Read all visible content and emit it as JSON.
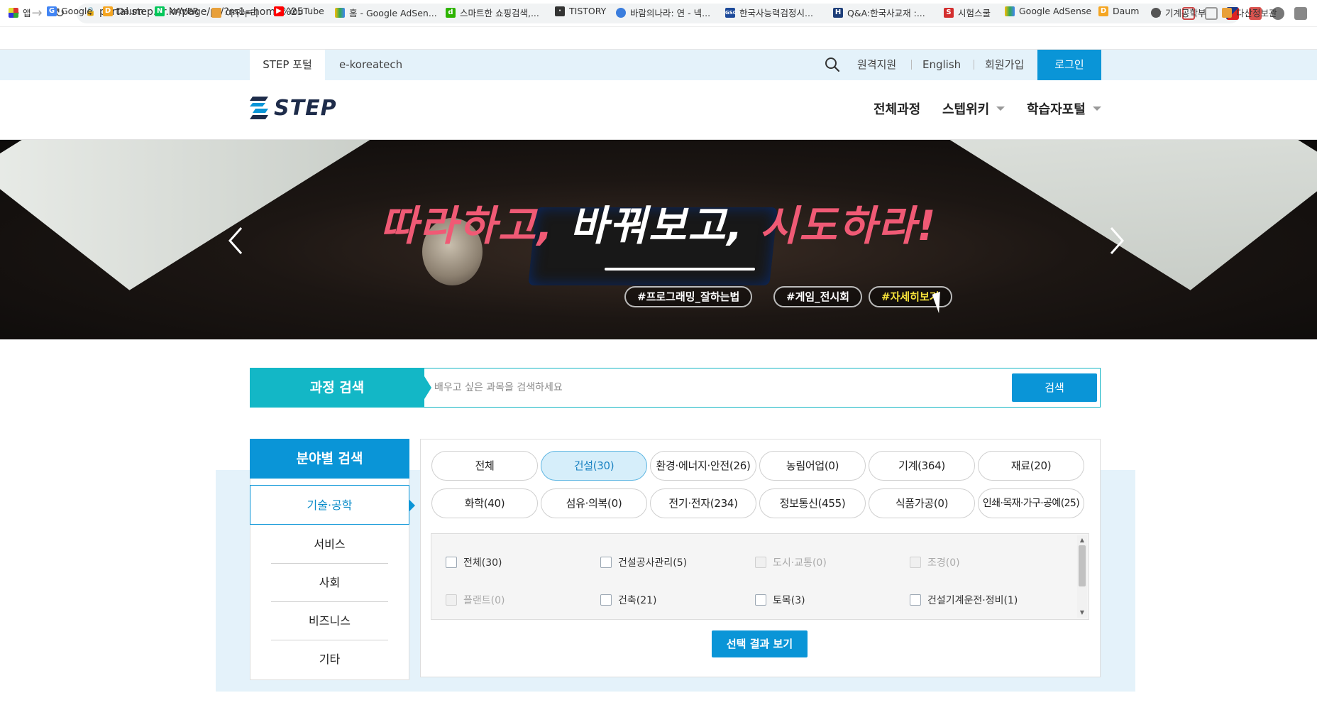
{
  "browser": {
    "url": "portal.step.or.kr/page/pt/?m1=home%25",
    "bookmarks": [
      "앱",
      "Google",
      "Daum",
      "NAVER",
      "아우누리",
      "YouTube",
      "홈 - Google AdSen...",
      "스마트한 쇼핑검색,...",
      "TISTORY",
      "바람의나라: 연 - 넥...",
      "한국사능력검정시...",
      "Q&A:한국사교재 :...",
      "시험스쿨",
      "Google AdSense",
      "Daum",
      "기계공학부",
      "다산정보관"
    ]
  },
  "topbar": {
    "tab_step": "STEP 포털",
    "tab_ekt": "e-koreatech",
    "remote": "원격지원",
    "english": "English",
    "signup": "회원가입",
    "login": "로그인"
  },
  "header": {
    "logo": "STEP",
    "nav": [
      "전체과정",
      "스텝위키",
      "학습자포털"
    ]
  },
  "banner": {
    "slogan_1": "따라하고,",
    "slogan_2": " 바꿔보고,",
    "slogan_3": " 시도하라!",
    "tags": [
      "#프로그래밍_잘하는법",
      "#게임_전시회",
      "#자세히보기"
    ]
  },
  "course_search": {
    "label": "과정 검색",
    "placeholder": "배우고 싶은 과목을 검색하세요",
    "button": "검색"
  },
  "field_search": {
    "title": "분야별 검색",
    "categories": [
      "기술·공학",
      "서비스",
      "사회",
      "비즈니스",
      "기타"
    ],
    "fields": [
      "전체",
      "건설(30)",
      "환경·에너지·안전(26)",
      "농림어업(0)",
      "기계(364)",
      "재료(20)",
      "화학(40)",
      "섬유·의복(0)",
      "전기·전자(234)",
      "정보통신(455)",
      "식품가공(0)",
      "인쇄·목재·가구·공예(25)"
    ],
    "subfields": [
      "전체(30)",
      "건설공사관리(5)",
      "도시·교통(0)",
      "조경(0)",
      "플랜트(0)",
      "건축(21)",
      "토목(3)",
      "건설기계운전·정비(1)"
    ],
    "result_button": "선택 결과 보기"
  },
  "colors": {
    "accent": "#0a95d7",
    "teal": "#13b7c6",
    "light_bg": "#e4f2fa",
    "slogan_pink": "#f05a75",
    "tag_yellow": "#f7e23a"
  }
}
